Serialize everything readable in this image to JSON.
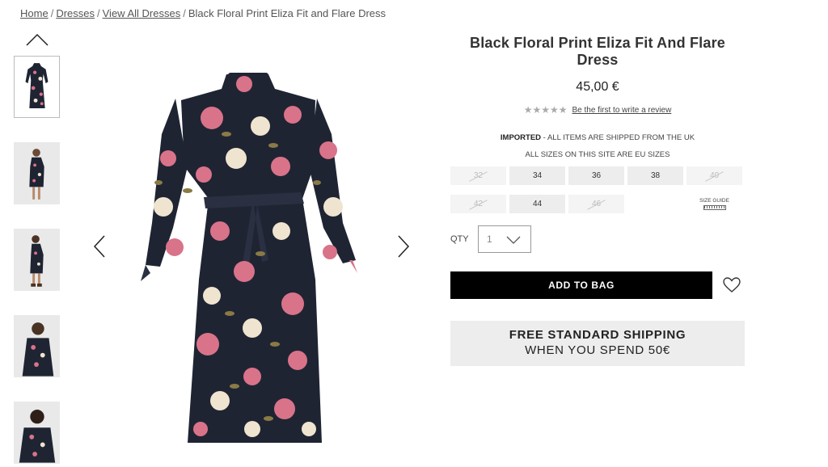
{
  "breadcrumb": {
    "home": "Home",
    "dresses": "Dresses",
    "view_all": "View All Dresses",
    "current": "Black Floral Print Eliza Fit and Flare Dress",
    "separator": "/"
  },
  "product": {
    "title": "Black Floral Print Eliza Fit And Flare Dress",
    "price": "45,00 €",
    "rating_stars": "★★★★★",
    "review_link": "Be the first to write a review"
  },
  "notice": {
    "imported_label": "IMPORTED",
    "imported_text": " - ALL ITEMS ARE SHIPPED FROM THE UK",
    "sizes_text": "ALL SIZES ON THIS SITE ARE EU SIZES"
  },
  "sizes": {
    "s32": "32",
    "s34": "34",
    "s36": "36",
    "s38": "38",
    "s40": "40",
    "s42": "42",
    "s44": "44",
    "s46": "46",
    "guide_label": "SIZE GUIDE"
  },
  "quantity": {
    "label": "QTY",
    "value": "1"
  },
  "actions": {
    "add_to_bag": "ADD TO BAG"
  },
  "shipping": {
    "line1": "FREE STANDARD SHIPPING",
    "line2": "WHEN YOU SPEND 50€"
  },
  "colors": {
    "dress_base": "#1f2433",
    "rose": "#d9738a",
    "cream": "#efe4cf",
    "leaf": "#8a7a45",
    "button_bg": "#000000",
    "panel_gray": "#ededed"
  }
}
